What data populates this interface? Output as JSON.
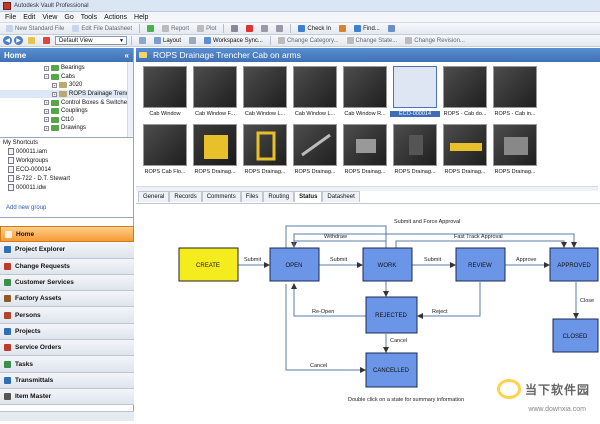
{
  "window": {
    "title": "Autodesk Vault Professional"
  },
  "menu": [
    "File",
    "Edit",
    "View",
    "Go",
    "Tools",
    "Actions",
    "Help"
  ],
  "toolbar1": {
    "new_standard_file": "New Standard File",
    "edit_file_datasheet": "Edit File Datasheet",
    "report": "Report",
    "plot": "Plot",
    "check_in": "Check In",
    "find": "Find..."
  },
  "toolbar2": {
    "view_select": "Default View",
    "layout": "Layout",
    "workspace_sync": "Workspace Sync...",
    "change_category": "Change Category...",
    "change_state": "Change State...",
    "change_revision": "Change Revision..."
  },
  "left_pane": {
    "title": "Home",
    "tree": [
      {
        "label": "Bearings",
        "indent": 2,
        "folder": "green"
      },
      {
        "label": "Cabs",
        "indent": 2,
        "folder": "green"
      },
      {
        "label": "3020",
        "indent": 3,
        "folder": "gray"
      },
      {
        "label": "ROPS Drainage Trench",
        "indent": 3,
        "folder": "gray",
        "selected": true
      },
      {
        "label": "Control Boxes & Switches",
        "indent": 2,
        "folder": "green"
      },
      {
        "label": "Couplings",
        "indent": 2,
        "folder": "green"
      },
      {
        "label": "Ct10",
        "indent": 2,
        "folder": "green"
      },
      {
        "label": "Drawings",
        "indent": 2,
        "folder": "green"
      }
    ],
    "shortcuts_title": "My Shortcuts",
    "shortcuts": [
      "000011.iam",
      "Workgroups",
      "ECO-000014",
      "B-722 - D.T. Stewart",
      "000011.idw"
    ],
    "add_group": "Add new group",
    "nav_items": [
      {
        "label": "Home",
        "color": "#e07a1f",
        "active": true
      },
      {
        "label": "Project Explorer",
        "color": "#2f6fb5"
      },
      {
        "label": "Change Requests",
        "color": "#c0392b"
      },
      {
        "label": "Customer Services",
        "color": "#3a8f4a"
      },
      {
        "label": "Factory Assets",
        "color": "#8e5a2b"
      },
      {
        "label": "Persons",
        "color": "#b5442f"
      },
      {
        "label": "Projects",
        "color": "#2f6fb5"
      },
      {
        "label": "Service Orders",
        "color": "#c0392b"
      },
      {
        "label": "Tasks",
        "color": "#3a8f4a"
      },
      {
        "label": "Transmittals",
        "color": "#2f6fb5"
      },
      {
        "label": "Item Master",
        "color": "#555"
      }
    ]
  },
  "right_pane": {
    "title": "ROPS Drainage Trencher Cab on arms",
    "thumbnails_row1": [
      "Cab Window",
      "Cab Window F...",
      "Cab Window L...",
      "Cab Window L...",
      "Cab Window R...",
      "ECO-000014",
      "ROPS - Cab do...",
      "ROPS - Cab in..."
    ],
    "thumbnails_row2": [
      "ROPS Cab Flo...",
      "ROPS Drainag...",
      "ROPS Drainag...",
      "ROPS Drainag...",
      "ROPS Drainag...",
      "ROPS Drainag...",
      "ROPS Drainag...",
      "ROPS Drainag..."
    ],
    "selected_thumb": "ECO-000014",
    "tabs": [
      "General",
      "Records",
      "Comments",
      "Files",
      "Routing",
      "Status",
      "Datasheet"
    ],
    "active_tab": "Status"
  },
  "diagram": {
    "states": {
      "create": "CREATE",
      "open": "OPEN",
      "work": "WORK",
      "review": "REVIEW",
      "approved": "APPROVED",
      "rejected": "REJECTED",
      "cancelled": "CANCELLED",
      "closed": "CLOSED"
    },
    "transitions": {
      "submit1": "Submit",
      "submit2": "Submit",
      "submit3": "Submit",
      "approve": "Approve",
      "withdraw": "Withdraw",
      "submit_force": "Submit and Force Approval",
      "fast_track": "Fast Track Approval",
      "reopen": "Re-Open",
      "reject": "Reject",
      "cancel1": "Cancel",
      "cancel2": "Cancel",
      "close": "Close"
    },
    "hint": "Double click on a state for summary information"
  },
  "watermark": {
    "text": "当下软件园",
    "url": "www.downxia.com"
  },
  "colors": {
    "header_blue": "#4a7fc4",
    "state_blue": "#6b96e8",
    "create_yellow": "#f5ec1d",
    "active_orange": "#f7a443"
  }
}
